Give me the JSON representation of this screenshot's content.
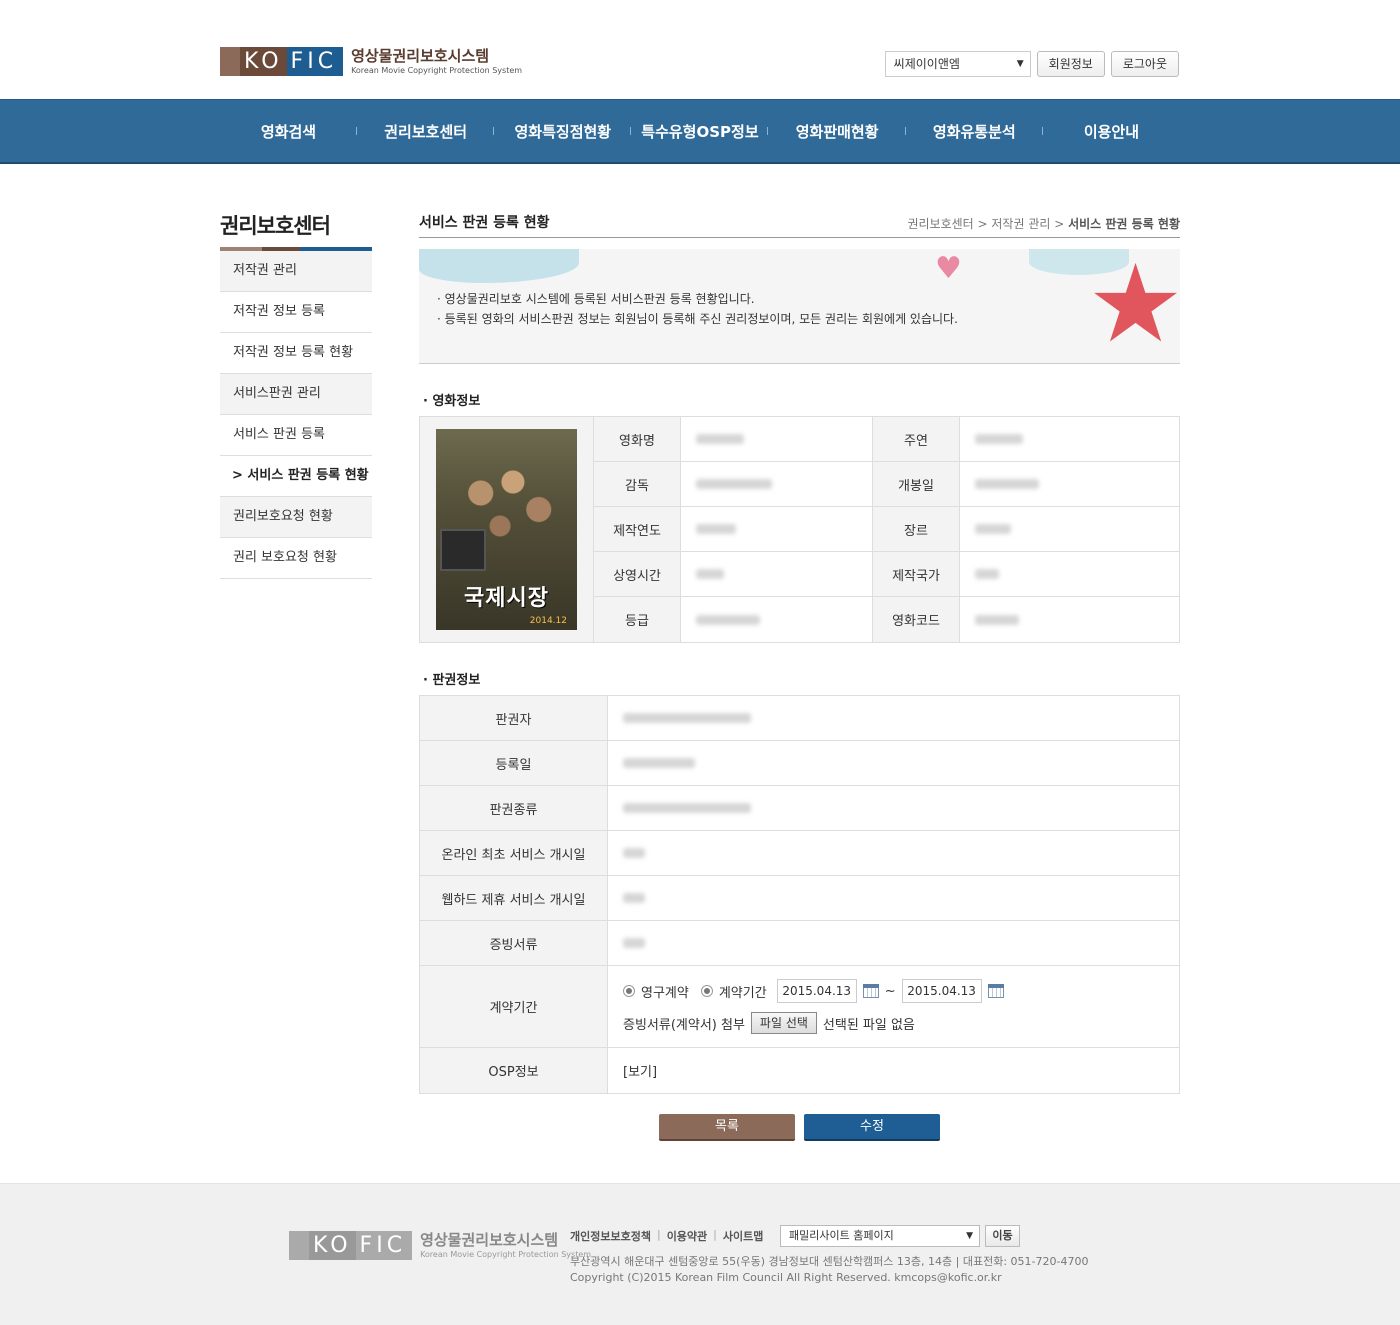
{
  "header": {
    "logo": {
      "letters_left": "KO",
      "letters_right": "FIC",
      "title": "영상물권리보호시스템",
      "subtitle": "Korean Movie Copyright Protection System"
    },
    "company_select": "씨제이이앤엠",
    "member_info_button": "회원정보",
    "logout_button": "로그아웃"
  },
  "gnb": [
    "영화검색",
    "권리보호센터",
    "영화특징점현황",
    "특수유형OSP정보",
    "영화판매현황",
    "영화유통분석",
    "이용안내"
  ],
  "lnb": {
    "title": "권리보호센터",
    "items": [
      {
        "label": "저작권 관리"
      },
      {
        "label": "저작권 정보 등록"
      },
      {
        "label": "저작권 정보 등록 현황"
      },
      {
        "label": "서비스판권 관리"
      },
      {
        "label": "서비스 판권 등록"
      },
      {
        "label": "> 서비스 판권 등록 현황"
      },
      {
        "label": "권리보호요청 현황"
      },
      {
        "label": "권리 보호요청 현황"
      }
    ]
  },
  "content": {
    "title": "서비스 판권 등록 현황",
    "breadcrumb": [
      "권리보호센터",
      "저작권 관리",
      "서비스 판권 등록 현황"
    ],
    "notice": [
      "영상물권리보호 시스템에 등록된 서비스판권 등록 현황입니다.",
      "등록된 영화의 서비스판권 정보는 회원님이 등록해 주신 권리정보이며, 모든 권리는 회원에게 있습니다."
    ],
    "movie_section": "영화정보",
    "poster": {
      "title": "국제시장",
      "date": "2014.12"
    },
    "movie_labels": [
      "영화명",
      "주연",
      "감독",
      "개봉일",
      "제작연도",
      "장르",
      "상영시간",
      "제작국가",
      "등급",
      "영화코드"
    ],
    "rights_section": "판권정보",
    "rights_labels": [
      "판권자",
      "등록일",
      "판권종류",
      "온라인 최초 서비스 개시일",
      "웹하드 제휴 서비스 개시일",
      "증빙서류",
      "계약기간",
      "OSP정보"
    ],
    "contract": {
      "radio_permanent": "영구계약",
      "radio_period": "계약기간",
      "start_date": "2015.04.13",
      "tilde": "~",
      "end_date": "2015.04.13",
      "attach_label": "증빙서류(계약서) 첨부",
      "file_button": "파일 선택",
      "no_file": "선택된 파일 없음"
    },
    "osp_link": "[보기]",
    "list_button": "목록",
    "edit_button": "수정"
  },
  "footer": {
    "logo": {
      "letters_left": "KO",
      "letters_right": "FIC",
      "title": "영상물권리보호시스템",
      "subtitle": "Korean Movie Copyright Protection System"
    },
    "links": [
      "개인정보보호정책",
      "이용약관",
      "사이트맵"
    ],
    "family_select": "패밀리사이트 홈페이지",
    "go_button": "이동",
    "address": "부산광역시 해운대구 센텀중앙로 55(우동) 경남정보대 센텀산학캠퍼스 13층, 14층 | 대표전화: 051-720-4700",
    "copyright": "Copyright (C)2015 Korean Film Council All Right Reserved. kmcops@kofic.or.kr"
  }
}
